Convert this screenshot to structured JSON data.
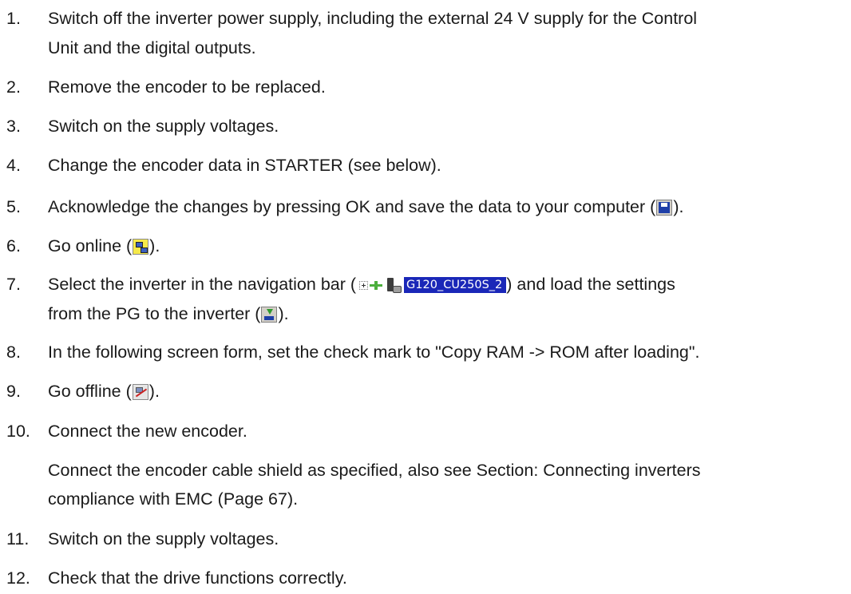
{
  "steps": [
    {
      "num": "1.",
      "text": "Switch off the inverter power supply, including the external 24 V supply for the Control",
      "text_line2": "Unit and the digital outputs."
    },
    {
      "num": "2.",
      "text": "Remove the encoder to be replaced."
    },
    {
      "num": "3.",
      "text": "Switch on the supply voltages."
    },
    {
      "num": "4.",
      "text": "Change the encoder data in STARTER (see below)."
    },
    {
      "num": "5.",
      "text_before": "Acknowledge the changes by pressing OK and save the data to your computer (",
      "text_after": ")."
    },
    {
      "num": "6.",
      "text_before": "Go online (",
      "text_after": ")."
    },
    {
      "num": "7.",
      "text_before": "Select the inverter in the navigation bar (",
      "nav_label": "G120_CU250S_2",
      "text_middle": ") and load the settings",
      "text_line2_before": "from the PG to the inverter (",
      "text_after": ")."
    },
    {
      "num": "8.",
      "text": "In the following screen form, set the check mark to \"Copy RAM -> ROM after loading\"."
    },
    {
      "num": "9.",
      "text_before": "Go offline (",
      "text_after": ")."
    },
    {
      "num": "10.",
      "text": "Connect the new encoder.",
      "para_line1": "Connect the encoder cable shield as specified, also see Section: Connecting inverters",
      "para_line2": "compliance with EMC (Page 67)."
    },
    {
      "num": "11.",
      "text": "Switch on the supply voltages."
    },
    {
      "num": "12.",
      "text": "Check that the drive functions correctly."
    }
  ],
  "icons": {
    "save": "floppy-disk-icon",
    "online": "go-online-icon",
    "offline": "go-offline-icon",
    "load": "load-to-target-icon",
    "nav_expand": "tree-expand-icon",
    "nav_network": "network-connector-icon",
    "nav_device": "drive-device-icon"
  },
  "colors": {
    "text": "#1a1a1a",
    "nav_highlight": "#1a27b8",
    "online_icon_bg": "#f5e94a"
  }
}
